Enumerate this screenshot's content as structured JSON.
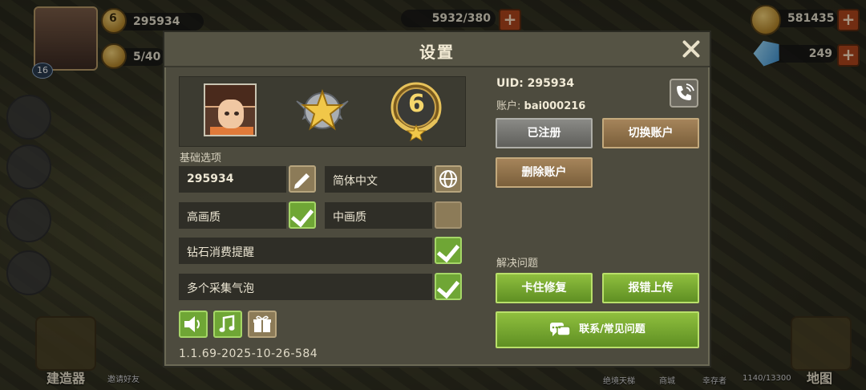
{
  "hud": {
    "player_id": "295934",
    "stamina_level": "6",
    "food": "5/40",
    "level_badge": "16",
    "energy": "5932/380",
    "coins": "581435",
    "gems": "249",
    "builder_label": "建造器",
    "invite_label": "邀请好友",
    "map_label": "地图",
    "bottom_labels": [
      "绝境天梯",
      "商城",
      "幸存者",
      "1140/13300"
    ]
  },
  "dialog": {
    "title": "设置",
    "rank_number": "6",
    "basic_options_label": "基础选项",
    "player_name": "295934",
    "language": "简体中文",
    "quality_high": "高画质",
    "quality_mid": "中画质",
    "diamond_reminder": "钻石消费提醒",
    "multi_bubble": "多个采集气泡",
    "version": "1.1.69-2025-10-26-584",
    "uid_text": "UID: 295934",
    "account_label": "账户:",
    "account_value": "bai000216",
    "registered_btn": "已注册",
    "switch_account_btn": "切换账户",
    "delete_account_btn": "删除账户",
    "help_label": "解决问题",
    "stuck_fix_btn": "卡住修复",
    "report_btn": "报错上传",
    "contact_btn": "联系/常见问题"
  },
  "colors": {
    "dialog_bg": "#4d4b3e",
    "green_accent": "#6fa635",
    "brown_accent": "#8c7b58"
  },
  "icons": [
    "pencil-icon",
    "globe-icon",
    "check-icon",
    "speaker-icon",
    "music-note-icon",
    "gift-icon",
    "phone-call-icon",
    "chat-bubble-icon",
    "close-icon"
  ]
}
